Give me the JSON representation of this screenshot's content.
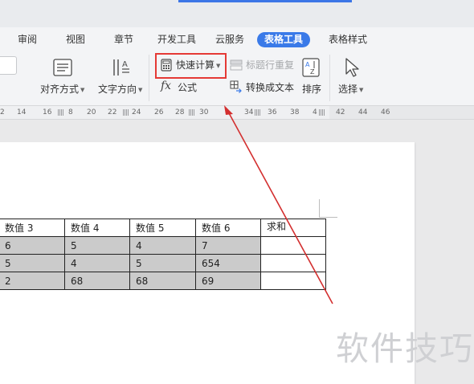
{
  "menu_tabs": [
    {
      "label": "审阅",
      "active": false
    },
    {
      "label": "视图",
      "active": false
    },
    {
      "label": "章节",
      "active": false
    },
    {
      "label": "开发工具",
      "active": false
    },
    {
      "label": "云服务",
      "active": false
    },
    {
      "label": "表格工具",
      "active": true
    },
    {
      "label": "表格样式",
      "active": false
    }
  ],
  "ribbon": {
    "align_label": "对齐方式",
    "text_dir_label": "文字方向",
    "quick_calc_label": "快速计算",
    "formula_label": "公式",
    "formula_icon_text": "fx",
    "repeat_header_label": "标题行重复",
    "convert_text_label": "转换成文本",
    "sort_label": "排序",
    "select_label": "选择"
  },
  "ruler": {
    "numbers": [
      "2",
      "14",
      "16",
      "8",
      "20",
      "22",
      "24",
      "26",
      "28",
      "30",
      "34",
      "36",
      "38",
      "4",
      "42",
      "44",
      "46"
    ]
  },
  "table": {
    "headers": [
      "数值 3",
      "数值 4",
      "数值 5",
      "数值 6",
      "求和"
    ],
    "rows": [
      [
        "6",
        "5",
        "4",
        "7",
        ""
      ],
      [
        "5",
        "4",
        "5",
        "654",
        ""
      ],
      [
        "2",
        "68",
        "68",
        "69",
        ""
      ]
    ]
  },
  "watermark": "软件技巧",
  "colors": {
    "accent": "#3a7ae8",
    "highlight_box": "#e53935",
    "arrow": "#d32f2f",
    "cell_shade": "#cbcbcb"
  }
}
